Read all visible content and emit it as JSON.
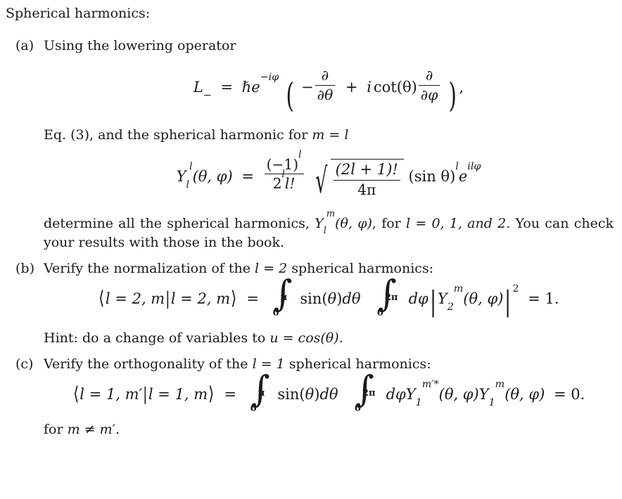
{
  "document": {
    "heading": "Spherical harmonics:",
    "items": [
      {
        "label": "(a)",
        "intro": "Using the lowering operator",
        "equation_1": {
          "lhs": "L",
          "lhs_sub": "−",
          "eq": "=",
          "hbar": "ℏ",
          "exp_base": "e",
          "exp_sup": "−iφ",
          "paren_open": "(",
          "minus": "−",
          "partial": "∂",
          "d_theta": "∂θ",
          "plus": "+",
          "i": "i",
          "cot": "cot(θ)",
          "d_phi": "∂φ",
          "paren_close": ")",
          "comma": ","
        },
        "mid_text_1": "Eq. (3), and the spherical harmonic for ",
        "mid_math_1": "m = l",
        "equation_2": {
          "Y": "Y",
          "Y_sub": "l",
          "Y_sup": "l",
          "args": "(θ, φ)",
          "eq": "=",
          "frac_num": "(−1)",
          "frac_num_sup": "l",
          "frac_den_base": "2",
          "frac_den_sup": "l",
          "frac_den_tail": "l!",
          "radical": "√",
          "sqrt_num": "(2l + 1)!",
          "sqrt_den": "4π",
          "sin_term": "(sin θ)",
          "sin_sup": "l",
          "exp_base": "e",
          "exp_sup": "ilφ"
        },
        "tail_text_a": "determine all the spherical harmonics, ",
        "tail_math_a_Y": "Y",
        "tail_math_a_sub": "l",
        "tail_math_a_sup": "m",
        "tail_math_a_args": "(θ, φ)",
        "tail_text_b": ", for ",
        "tail_math_b": "l = 0, 1, and 2.",
        "tail_text_c": "  You can check your results with those in the book."
      },
      {
        "label": "(b)",
        "intro_pre": "Verify the normalization of the ",
        "intro_math": "l = 2",
        "intro_post": " spherical harmonics:",
        "equation_3": {
          "bra_open": "⟨",
          "bra": "l = 2, m",
          "bar": "|",
          "ket": "l = 2, m",
          "ket_close": "⟩",
          "eq": "=",
          "int1_lower": "0",
          "int1_upper": "π",
          "int1_body": "sin(θ)dθ",
          "int2_lower": "0",
          "int2_upper": "2π",
          "int2_body": "dφ",
          "abs_open": "|",
          "Y": "Y",
          "Y_sub": "2",
          "Y_sup": "m",
          "args": "(θ, φ)",
          "abs_close": "|",
          "abs_sup": "2",
          "result": "= 1."
        },
        "hint_pre": "Hint: do a change of variables to ",
        "hint_math": "u = cos(θ)",
        "hint_post": "."
      },
      {
        "label": "(c)",
        "intro_pre": "Verify the orthogonality of the ",
        "intro_math": "l = 1",
        "intro_post": " spherical harmonics:",
        "equation_4": {
          "bra_open": "⟨",
          "bra": "l = 1, m′",
          "bar": "|",
          "ket": "l = 1, m",
          "ket_close": "⟩",
          "eq": "=",
          "int1_lower": "0",
          "int1_upper": "π",
          "int1_body": "sin(θ)dθ",
          "int2_lower": "0",
          "int2_upper": "2π",
          "int2_body": "dφ",
          "Y1": "Y",
          "Y1_sub": "1",
          "Y1_sup": "m′*",
          "Y1_args": "(θ, φ)",
          "Y2": "Y",
          "Y2_sub": "1",
          "Y2_sup": "m",
          "Y2_args": "(θ, φ)",
          "result": "= 0."
        },
        "closing_pre": "for ",
        "closing_math": "m ≠ m′",
        "closing_post": "."
      }
    ]
  }
}
